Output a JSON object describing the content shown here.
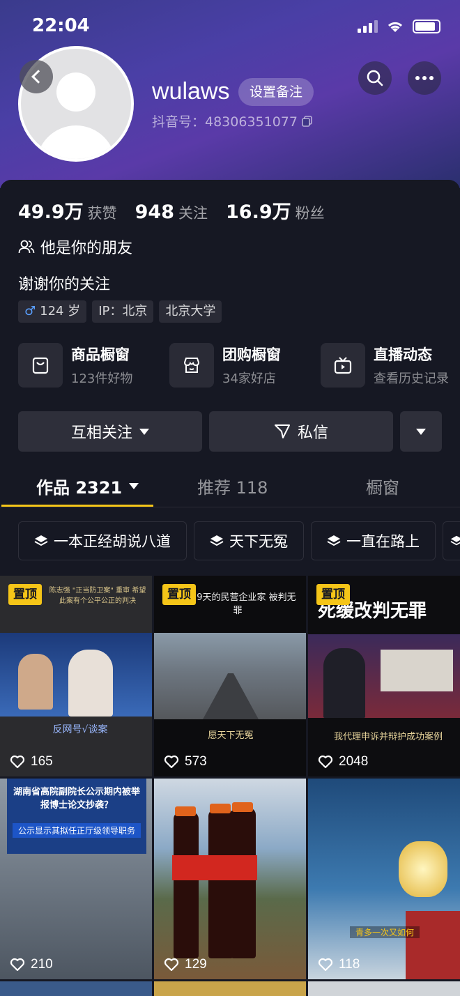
{
  "status": {
    "time": "22:04"
  },
  "profile": {
    "username": "wulaws",
    "remark_button": "设置备注",
    "douyin_id": "抖音号：48306351077",
    "stats": [
      {
        "value": "49.9万",
        "label": "获赞"
      },
      {
        "value": "948",
        "label": "关注"
      },
      {
        "value": "16.9万",
        "label": "粉丝"
      }
    ],
    "friend_text": "他是你的朋友",
    "bio": "谢谢你的关注",
    "tags": {
      "age": "124 岁",
      "ip": "IP：北京",
      "school": "北京大学"
    }
  },
  "shops": [
    {
      "title": "商品橱窗",
      "sub": "123件好物",
      "icon": "bag-icon"
    },
    {
      "title": "团购橱窗",
      "sub": "34家好店",
      "icon": "store-icon"
    },
    {
      "title": "直播动态",
      "sub": "查看历史记录",
      "icon": "tv-icon"
    }
  ],
  "actions": {
    "follow": "互相关注",
    "message": "私信"
  },
  "tabs": [
    {
      "label": "作品 2321",
      "active": true
    },
    {
      "label": "推荐 118",
      "active": false
    },
    {
      "label": "橱窗",
      "active": false
    }
  ],
  "collections": [
    "一本正经胡说八道",
    "天下无冤",
    "一直在路上"
  ],
  "videos": [
    {
      "pinned": true,
      "pin_label": "置顶",
      "likes": "165",
      "caption_top": "陈志强 \"正当防卫案\" 重审 希望此案有个公平公正的判决",
      "caption_bottom": "反网号√谈案"
    },
    {
      "pinned": true,
      "pin_label": "置顶",
      "likes": "573",
      "caption_top": "1579天的民营企业家 被判无罪",
      "caption_bottom": "愿天下无冤"
    },
    {
      "pinned": true,
      "pin_label": "置顶",
      "likes": "2048",
      "caption_top": "死缓改判无罪",
      "caption_bottom": "我代理申诉并辩护成功案例"
    },
    {
      "pinned": false,
      "likes": "210",
      "caption_top": "湖南省高院副院长公示期内被举报博士论文抄袭？",
      "caption_bottom": "公示显示其拟任正厅级领导职务"
    },
    {
      "pinned": false,
      "likes": "129",
      "caption_top": "",
      "caption_bottom": ""
    },
    {
      "pinned": false,
      "likes": "118",
      "caption_top": "",
      "caption_bottom": "青多一次又如何"
    }
  ],
  "colors": {
    "accent": "#f5c518",
    "background": "#161823",
    "header_gradient": "#4a3fa6"
  }
}
